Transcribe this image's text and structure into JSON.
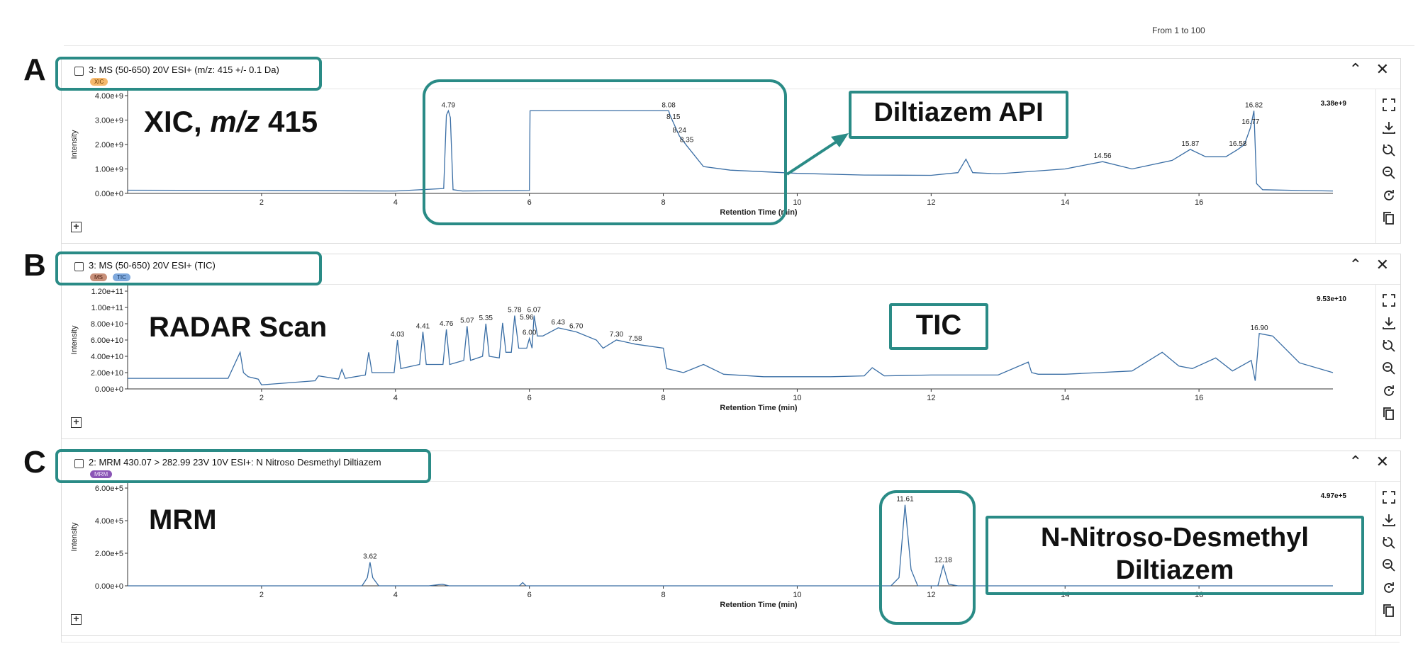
{
  "page_range": "From 1 to 100",
  "panels": [
    {
      "letter": "A",
      "trace_title": "3: MS (50-650) 20V ESI+ (m/z: 415 +/- 0.1 Da)",
      "badges": [
        "XIC"
      ],
      "max_value": "3.38e+9",
      "big_label_parts": [
        "XIC, ",
        "m/z",
        " 415"
      ],
      "callout": "Diltiazem API"
    },
    {
      "letter": "B",
      "trace_title": "3: MS (50-650) 20V ESI+ (TIC)",
      "badges": [
        "MS",
        "TIC"
      ],
      "max_value": "9.53e+10",
      "big_label": "RADAR Scan",
      "callout": "TIC"
    },
    {
      "letter": "C",
      "trace_title": "2: MRM 430.07 > 282.99 23V 10V ESI+: N Nitroso Desmethyl Diltiazem",
      "badges": [
        "MRM"
      ],
      "max_value": "4.97e+5",
      "big_label": "MRM",
      "callout_lines": [
        "N-Nitroso-Desmethyl",
        "Diltiazem"
      ]
    }
  ],
  "icons": [
    "collapse-icon",
    "close-icon",
    "fullscreen-icon",
    "download-icon",
    "zoom-reset-icon",
    "zoom-out-icon",
    "refresh-icon",
    "copy-icon",
    "expand-icon"
  ],
  "colors": {
    "trace": "#3a6ea5",
    "highlight": "#2a8b86"
  },
  "chart_data": [
    {
      "type": "line",
      "xlabel": "Retention Time (min)",
      "ylabel": "Intensity",
      "xlim": [
        0,
        18
      ],
      "ylim": [
        0,
        4000000000
      ],
      "x_ticks": [
        2,
        4,
        6,
        8,
        10,
        12,
        14,
        16
      ],
      "y_ticks": [
        "0.00e+0",
        "1.00e+9",
        "2.00e+9",
        "3.00e+9",
        "4.00e+9"
      ],
      "y_tick_values": [
        0,
        1000000000,
        2000000000,
        3000000000,
        4000000000
      ],
      "x": [
        0,
        2,
        3.9,
        4.0,
        4.72,
        4.76,
        4.79,
        4.82,
        4.86,
        5.0,
        6.0,
        6.01,
        6.03,
        8.08,
        8.1,
        8.15,
        8.24,
        8.35,
        8.6,
        9.0,
        10.0,
        11.0,
        12.0,
        12.4,
        12.52,
        12.62,
        13.0,
        14.0,
        14.56,
        15.0,
        15.6,
        15.87,
        16.1,
        16.4,
        16.58,
        16.68,
        16.77,
        16.82,
        16.86,
        16.95,
        17.5,
        18.0
      ],
      "y": [
        130000000.0,
        120000000.0,
        100000000.0,
        100000000.0,
        200000000.0,
        3200000000.0,
        3380000000.0,
        3100000000.0,
        150000000.0,
        100000000.0,
        120000000.0,
        3380000000.0,
        3380000000.0,
        3380000000.0,
        3200000000.0,
        2900000000.0,
        2350000000.0,
        1950000000.0,
        1100000000.0,
        950000000.0,
        820000000.0,
        750000000.0,
        740000000.0,
        850000000.0,
        1400000000.0,
        850000000.0,
        800000000.0,
        1000000000.0,
        1300000000.0,
        1000000000.0,
        1350000000.0,
        1800000000.0,
        1500000000.0,
        1500000000.0,
        1800000000.0,
        2000000000.0,
        2700000000.0,
        3380000000.0,
        400000000.0,
        150000000.0,
        120000000.0,
        100000000.0
      ],
      "peak_labels": [
        {
          "x": 4.79,
          "y": 3380000000.0,
          "text": "4.79"
        },
        {
          "x": 8.08,
          "y": 3380000000.0,
          "text": "8.08"
        },
        {
          "x": 8.15,
          "y": 2900000000.0,
          "text": "8.15"
        },
        {
          "x": 8.24,
          "y": 2350000000.0,
          "text": "8.24"
        },
        {
          "x": 8.35,
          "y": 1950000000.0,
          "text": "8.35"
        },
        {
          "x": 14.56,
          "y": 1300000000.0,
          "text": "14.56"
        },
        {
          "x": 15.87,
          "y": 1800000000.0,
          "text": "15.87"
        },
        {
          "x": 16.58,
          "y": 1800000000.0,
          "text": "16.58"
        },
        {
          "x": 16.77,
          "y": 2700000000.0,
          "text": "16.77"
        },
        {
          "x": 16.82,
          "y": 3380000000.0,
          "text": "16.82"
        }
      ]
    },
    {
      "type": "line",
      "xlabel": "Retention Time (min)",
      "ylabel": "Intensity",
      "xlim": [
        0,
        18
      ],
      "ylim": [
        0,
        120000000000
      ],
      "x_ticks": [
        2,
        4,
        6,
        8,
        10,
        12,
        14,
        16
      ],
      "y_ticks": [
        "0.00e+0",
        "2.00e+10",
        "4.00e+10",
        "6.00e+10",
        "8.00e+10",
        "1.00e+11",
        "1.20e+11"
      ],
      "y_tick_values": [
        0,
        20000000000,
        40000000000,
        60000000000,
        80000000000,
        100000000000,
        120000000000
      ],
      "x": [
        0,
        1.5,
        1.68,
        1.73,
        1.8,
        1.95,
        2.0,
        2.8,
        2.85,
        3.15,
        3.2,
        3.25,
        3.55,
        3.6,
        3.65,
        3.98,
        4.03,
        4.08,
        4.36,
        4.41,
        4.46,
        4.71,
        4.76,
        4.81,
        5.02,
        5.07,
        5.12,
        5.3,
        5.35,
        5.4,
        5.55,
        5.6,
        5.65,
        5.73,
        5.78,
        5.84,
        5.96,
        6.0,
        6.04,
        6.07,
        6.12,
        6.2,
        6.43,
        6.7,
        7.0,
        7.1,
        7.3,
        7.58,
        8.0,
        8.05,
        8.3,
        8.6,
        8.9,
        9.5,
        10.5,
        11.0,
        11.12,
        11.3,
        12.0,
        13.0,
        13.45,
        13.5,
        13.6,
        14.0,
        15.0,
        15.45,
        15.7,
        15.9,
        16.25,
        16.5,
        16.78,
        16.84,
        16.9,
        17.1,
        17.5,
        18.0
      ],
      "y": [
        13000000000.0,
        13000000000.0,
        45000000000.0,
        20000000000.0,
        15000000000.0,
        12000000000.0,
        5000000000.0,
        10000000000.0,
        16000000000.0,
        12000000000.0,
        24000000000.0,
        13000000000.0,
        17000000000.0,
        45000000000.0,
        20000000000.0,
        20000000000.0,
        60000000000.0,
        25000000000.0,
        30000000000.0,
        70000000000.0,
        30000000000.0,
        30000000000.0,
        73000000000.0,
        30000000000.0,
        35000000000.0,
        77000000000.0,
        35000000000.0,
        40000000000.0,
        80000000000.0,
        40000000000.0,
        38000000000.0,
        81000000000.0,
        45000000000.0,
        45000000000.0,
        90000000000.0,
        50000000000.0,
        50000000000.0,
        62000000000.0,
        50000000000.0,
        90000000000.0,
        65000000000.0,
        65000000000.0,
        75000000000.0,
        70000000000.0,
        60000000000.0,
        50000000000.0,
        60000000000.0,
        55000000000.0,
        50000000000.0,
        25000000000.0,
        20000000000.0,
        30000000000.0,
        18000000000.0,
        15000000000.0,
        15000000000.0,
        16000000000.0,
        26000000000.0,
        16000000000.0,
        17000000000.0,
        17000000000.0,
        33000000000.0,
        20000000000.0,
        18000000000.0,
        18000000000.0,
        22000000000.0,
        45000000000.0,
        28000000000.0,
        25000000000.0,
        38000000000.0,
        22000000000.0,
        35000000000.0,
        10000000000.0,
        68000000000.0,
        65000000000.0,
        32000000000.0,
        20000000000.0
      ],
      "peak_labels": [
        {
          "x": 4.03,
          "y": 60000000000.0,
          "text": "4.03"
        },
        {
          "x": 4.41,
          "y": 70000000000.0,
          "text": "4.41"
        },
        {
          "x": 4.76,
          "y": 73000000000.0,
          "text": "4.76"
        },
        {
          "x": 5.07,
          "y": 77000000000.0,
          "text": "5.07"
        },
        {
          "x": 5.35,
          "y": 80000000000.0,
          "text": "5.35"
        },
        {
          "x": 5.78,
          "y": 90000000000.0,
          "text": "5.78"
        },
        {
          "x": 5.96,
          "y": 81000000000.0,
          "text": "5.96"
        },
        {
          "x": 6.0,
          "y": 62000000000.0,
          "text": "6.00"
        },
        {
          "x": 6.07,
          "y": 90000000000.0,
          "text": "6.07"
        },
        {
          "x": 6.43,
          "y": 75000000000.0,
          "text": "6.43"
        },
        {
          "x": 6.7,
          "y": 70000000000.0,
          "text": "6.70"
        },
        {
          "x": 7.3,
          "y": 60000000000.0,
          "text": "7.30"
        },
        {
          "x": 7.58,
          "y": 55000000000.0,
          "text": "7.58"
        },
        {
          "x": 16.9,
          "y": 68000000000.0,
          "text": "16.90"
        }
      ]
    },
    {
      "type": "line",
      "xlabel": "Retention Time (min)",
      "ylabel": "Intensity",
      "xlim": [
        0,
        18
      ],
      "ylim": [
        0,
        600000
      ],
      "x_ticks": [
        2,
        4,
        6,
        8,
        10,
        12,
        14,
        16
      ],
      "y_ticks": [
        "0.00e+0",
        "2.00e+5",
        "4.00e+5",
        "6.00e+5"
      ],
      "y_tick_values": [
        0,
        200000,
        400000,
        600000
      ],
      "x": [
        0,
        3.5,
        3.58,
        3.62,
        3.66,
        3.75,
        4.5,
        4.7,
        4.8,
        5.85,
        5.9,
        5.95,
        11.4,
        11.52,
        11.61,
        11.7,
        11.8,
        12.1,
        12.18,
        12.26,
        12.4,
        18.0
      ],
      "y": [
        0,
        0,
        50000.0,
        145000.0,
        50000.0,
        0,
        0,
        10000.0,
        0,
        0,
        20000.0,
        0,
        0,
        50000.0,
        497000.0,
        100000.0,
        0,
        0,
        125000.0,
        10000.0,
        0,
        0
      ],
      "peak_labels": [
        {
          "x": 3.62,
          "y": 145000.0,
          "text": "3.62"
        },
        {
          "x": 11.61,
          "y": 497000.0,
          "text": "11.61"
        },
        {
          "x": 12.18,
          "y": 125000.0,
          "text": "12.18"
        }
      ]
    }
  ]
}
